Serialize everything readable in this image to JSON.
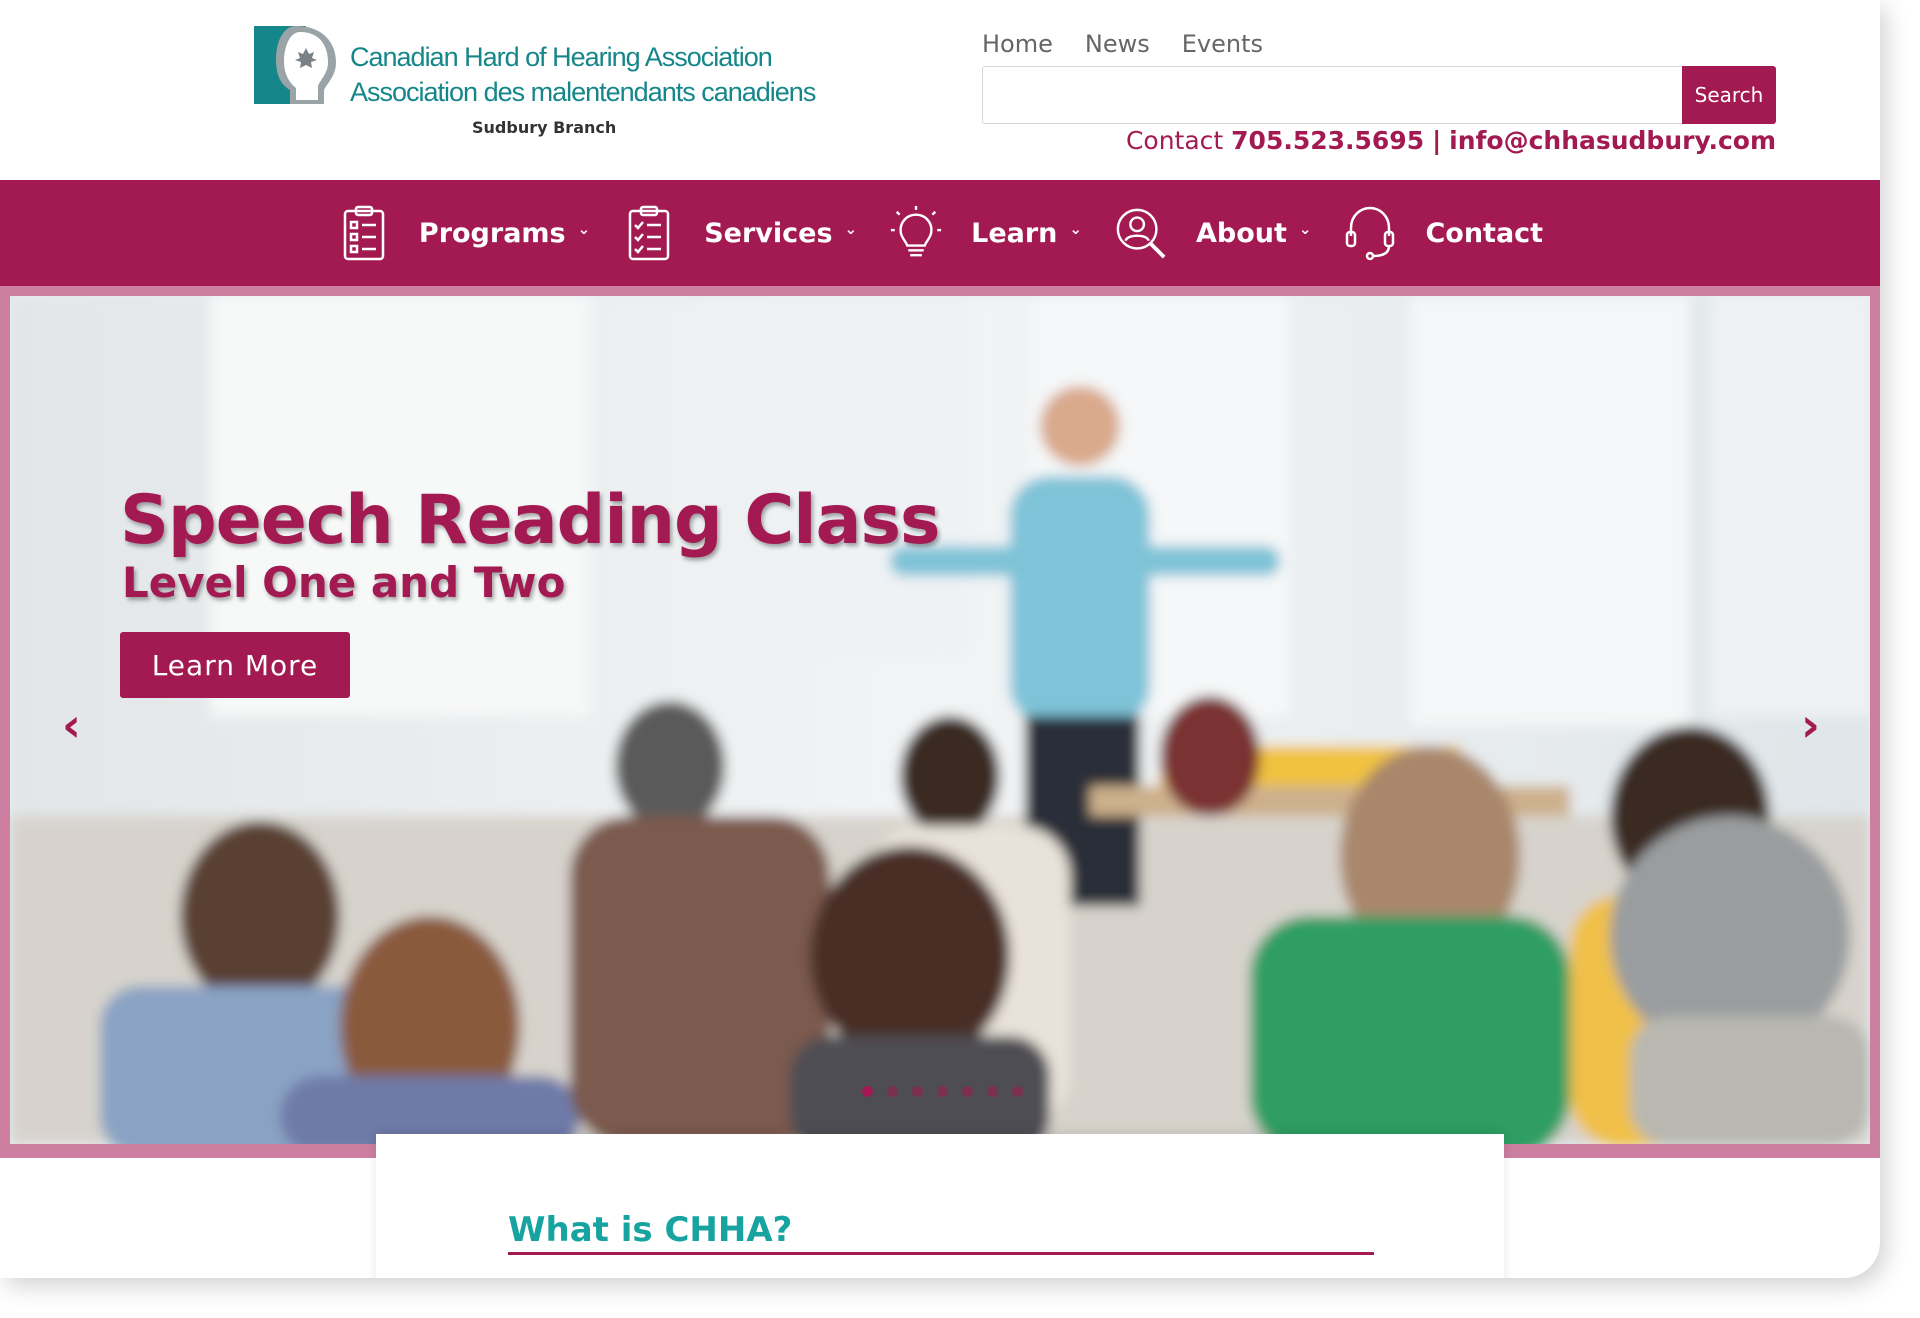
{
  "header": {
    "logo": {
      "line1": "Canadian Hard of Hearing Association",
      "line2": "Association des malentendants canadiens",
      "branch": "Sudbury Branch"
    },
    "top_links": [
      "Home",
      "News",
      "Events"
    ],
    "search": {
      "value": "",
      "placeholder": "",
      "button_label": "Search"
    },
    "contact": {
      "prefix": "Contact",
      "phone": "705.523.5695",
      "separator": "|",
      "email": "info@chhasudbury.com"
    }
  },
  "main_nav": [
    {
      "label": "Programs",
      "icon": "clipboard-icon",
      "has_dropdown": true
    },
    {
      "label": "Services",
      "icon": "checklist-icon",
      "has_dropdown": true
    },
    {
      "label": "Learn",
      "icon": "lightbulb-icon",
      "has_dropdown": true
    },
    {
      "label": "About",
      "icon": "search-person-icon",
      "has_dropdown": true
    },
    {
      "label": "Contact",
      "icon": "headset-icon",
      "has_dropdown": false
    }
  ],
  "hero": {
    "title": "Speech Reading Class",
    "subtitle": "Level One and Two",
    "cta_label": "Learn More",
    "slide_count": 7,
    "active_slide": 1
  },
  "section": {
    "title": "What is CHHA?"
  },
  "colors": {
    "brand": "#a31a52",
    "teal": "#17a3a0",
    "hero_border": "#cc7fa0"
  }
}
